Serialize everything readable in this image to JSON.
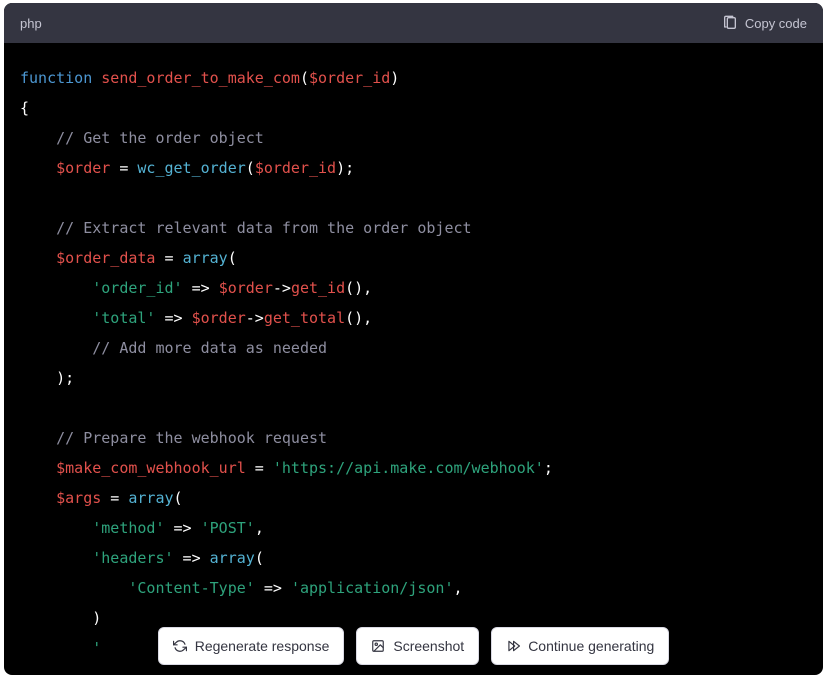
{
  "header": {
    "language": "php",
    "copy_label": "Copy code"
  },
  "code": {
    "tokens": [
      {
        "cls": "tok-keyword",
        "t": "function"
      },
      {
        "cls": "tok-white",
        "t": " "
      },
      {
        "cls": "tok-func",
        "t": "send_order_to_make_com"
      },
      {
        "cls": "tok-punct",
        "t": "("
      },
      {
        "cls": "tok-var",
        "t": "$order_id"
      },
      {
        "cls": "tok-punct",
        "t": ")"
      },
      {
        "br": 1
      },
      {
        "cls": "tok-punct",
        "t": "{"
      },
      {
        "br": 1
      },
      {
        "cls": "tok-white",
        "t": "    "
      },
      {
        "cls": "tok-comment",
        "t": "// Get the order object"
      },
      {
        "br": 1
      },
      {
        "cls": "tok-white",
        "t": "    "
      },
      {
        "cls": "tok-var",
        "t": "$order"
      },
      {
        "cls": "tok-white",
        "t": " = "
      },
      {
        "cls": "tok-builtin",
        "t": "wc_get_order"
      },
      {
        "cls": "tok-punct",
        "t": "("
      },
      {
        "cls": "tok-var",
        "t": "$order_id"
      },
      {
        "cls": "tok-punct",
        "t": ");"
      },
      {
        "br": 1
      },
      {
        "br": 1
      },
      {
        "cls": "tok-white",
        "t": "    "
      },
      {
        "cls": "tok-comment",
        "t": "// Extract relevant data from the order object"
      },
      {
        "br": 1
      },
      {
        "cls": "tok-white",
        "t": "    "
      },
      {
        "cls": "tok-var",
        "t": "$order_data"
      },
      {
        "cls": "tok-white",
        "t": " = "
      },
      {
        "cls": "tok-builtin",
        "t": "array"
      },
      {
        "cls": "tok-punct",
        "t": "("
      },
      {
        "br": 1
      },
      {
        "cls": "tok-white",
        "t": "        "
      },
      {
        "cls": "tok-string",
        "t": "'order_id'"
      },
      {
        "cls": "tok-white",
        "t": " => "
      },
      {
        "cls": "tok-var",
        "t": "$order"
      },
      {
        "cls": "tok-white",
        "t": "->"
      },
      {
        "cls": "tok-method",
        "t": "get_id"
      },
      {
        "cls": "tok-punct",
        "t": "(),"
      },
      {
        "br": 1
      },
      {
        "cls": "tok-white",
        "t": "        "
      },
      {
        "cls": "tok-string",
        "t": "'total'"
      },
      {
        "cls": "tok-white",
        "t": " => "
      },
      {
        "cls": "tok-var",
        "t": "$order"
      },
      {
        "cls": "tok-white",
        "t": "->"
      },
      {
        "cls": "tok-method",
        "t": "get_total"
      },
      {
        "cls": "tok-punct",
        "t": "(),"
      },
      {
        "br": 1
      },
      {
        "cls": "tok-white",
        "t": "        "
      },
      {
        "cls": "tok-comment",
        "t": "// Add more data as needed"
      },
      {
        "br": 1
      },
      {
        "cls": "tok-white",
        "t": "    "
      },
      {
        "cls": "tok-punct",
        "t": ");"
      },
      {
        "br": 1
      },
      {
        "br": 1
      },
      {
        "cls": "tok-white",
        "t": "    "
      },
      {
        "cls": "tok-comment",
        "t": "// Prepare the webhook request"
      },
      {
        "br": 1
      },
      {
        "cls": "tok-white",
        "t": "    "
      },
      {
        "cls": "tok-var",
        "t": "$make_com_webhook_url"
      },
      {
        "cls": "tok-white",
        "t": " = "
      },
      {
        "cls": "tok-string",
        "t": "'https://api.make.com/webhook'"
      },
      {
        "cls": "tok-punct",
        "t": ";"
      },
      {
        "br": 1
      },
      {
        "cls": "tok-white",
        "t": "    "
      },
      {
        "cls": "tok-var",
        "t": "$args"
      },
      {
        "cls": "tok-white",
        "t": " = "
      },
      {
        "cls": "tok-builtin",
        "t": "array"
      },
      {
        "cls": "tok-punct",
        "t": "("
      },
      {
        "br": 1
      },
      {
        "cls": "tok-white",
        "t": "        "
      },
      {
        "cls": "tok-string",
        "t": "'method'"
      },
      {
        "cls": "tok-white",
        "t": " => "
      },
      {
        "cls": "tok-string",
        "t": "'POST'"
      },
      {
        "cls": "tok-punct",
        "t": ","
      },
      {
        "br": 1
      },
      {
        "cls": "tok-white",
        "t": "        "
      },
      {
        "cls": "tok-string",
        "t": "'headers'"
      },
      {
        "cls": "tok-white",
        "t": " => "
      },
      {
        "cls": "tok-builtin",
        "t": "array"
      },
      {
        "cls": "tok-punct",
        "t": "("
      },
      {
        "br": 1
      },
      {
        "cls": "tok-white",
        "t": "            "
      },
      {
        "cls": "tok-string",
        "t": "'Content-Type'"
      },
      {
        "cls": "tok-white",
        "t": " => "
      },
      {
        "cls": "tok-string",
        "t": "'application/json'"
      },
      {
        "cls": "tok-punct",
        "t": ","
      },
      {
        "br": 1
      },
      {
        "cls": "tok-white",
        "t": "        "
      },
      {
        "cls": "tok-punct",
        "t": ")"
      },
      {
        "br": 1
      },
      {
        "cls": "tok-white",
        "t": "        "
      },
      {
        "cls": "tok-string",
        "t": "'"
      },
      {
        "cls": "tok-white",
        "t": "                   "
      },
      {
        "cls": "tok-var",
        "t": "$"
      }
    ]
  },
  "actions": {
    "regenerate": "Regenerate response",
    "screenshot": "Screenshot",
    "continue": "Continue generating"
  }
}
